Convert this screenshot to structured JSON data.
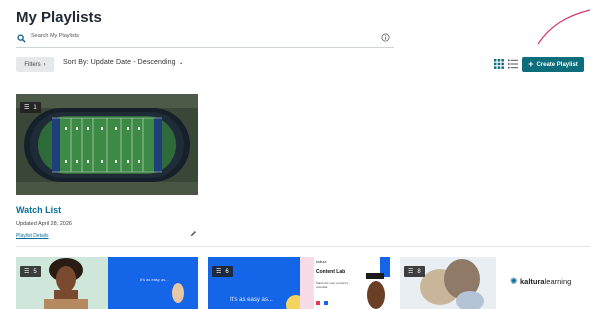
{
  "page": {
    "title": "My Playlists"
  },
  "search": {
    "placeholder": "Search My Playlists"
  },
  "toolbar": {
    "filters_label": "Filters",
    "filters_chevron": "›",
    "sort_label": "Sort By: Update Date - Descending",
    "sort_chevron": "⌄",
    "create_label": "Create Playlist",
    "create_icon": "+"
  },
  "colors": {
    "accent": "#0b6e7a",
    "link": "#0b6e9a",
    "deco_arc": "#d6336c"
  },
  "playlists": [
    {
      "count": "1",
      "title": "Watch List",
      "updated": "Updated April 28, 2026",
      "details_link": "Playlist Details"
    }
  ],
  "row2": {
    "tiles": [
      {
        "count": "5",
        "slide_text": "It's as easy as..."
      },
      {
        "count": "6",
        "slide_text": "It's as easy as...",
        "logo_text": "kaltura",
        "heading": "Content Lab",
        "subtext": "Maximize your content's potential"
      },
      {
        "count": "8",
        "brand_text": "kaltura",
        "brand_suffix": "learning"
      }
    ]
  }
}
